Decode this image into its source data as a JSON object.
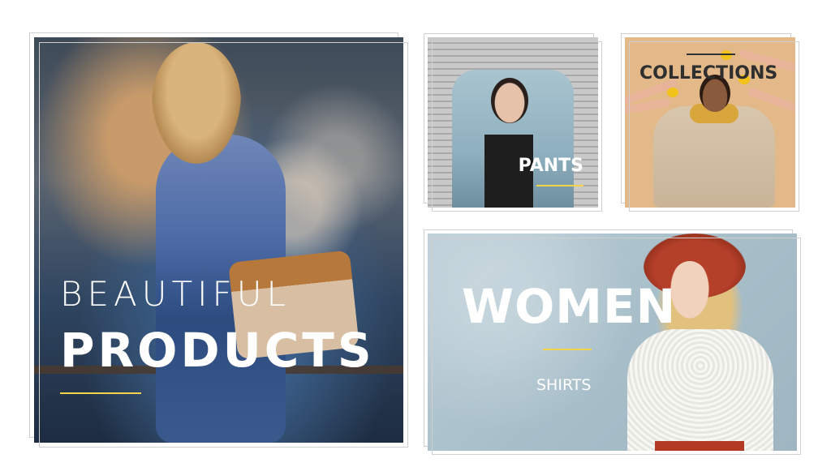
{
  "tiles": {
    "main": {
      "line1": "BEAUTIFUL",
      "line2": "PRODUCTS"
    },
    "pants": {
      "label": "PANTS"
    },
    "collections": {
      "label": "COLLECTIONS"
    },
    "women": {
      "title": "WOMEN",
      "subtitle": "SHIRTS"
    }
  },
  "colors": {
    "accent_line": "#f2d34a",
    "frame_border": "#cfcfcf",
    "text_light": "#ffffff",
    "text_dark": "#2f2f2f"
  },
  "icons": []
}
